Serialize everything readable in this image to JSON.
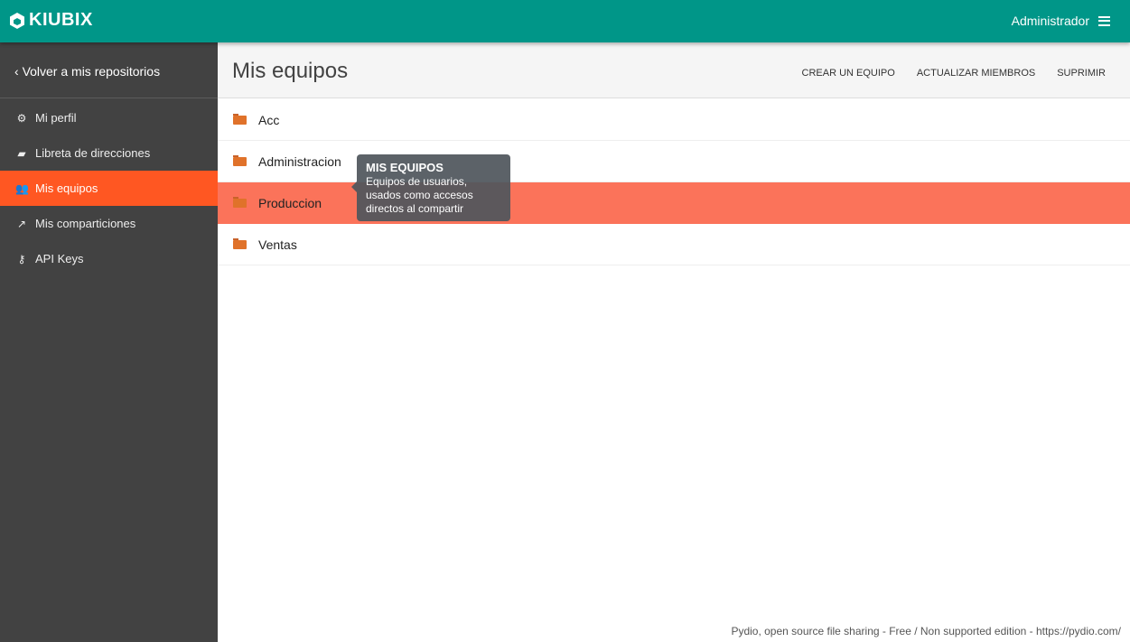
{
  "topbar": {
    "brand": "KIUBIX",
    "user": "Administrador"
  },
  "sidebar": {
    "back": "Volver a mis repositorios",
    "items": [
      {
        "label": "Mi perfil",
        "icon": "gear-icon"
      },
      {
        "label": "Libreta de direcciones",
        "icon": "book-icon"
      },
      {
        "label": "Mis equipos",
        "icon": "users-icon",
        "active": true
      },
      {
        "label": "Mis comparticiones",
        "icon": "share-icon"
      },
      {
        "label": "API Keys",
        "icon": "key-icon"
      }
    ]
  },
  "header": {
    "title": "Mis equipos",
    "actions": [
      "CREAR UN EQUIPO",
      "ACTUALIZAR MIEMBROS",
      "SUPRIMIR"
    ]
  },
  "teams": [
    "Acc",
    "Administracion",
    "Produccion",
    "Ventas"
  ],
  "tooltip": {
    "title": "MIS EQUIPOS",
    "text": "Equipos de usuarios, usados como accesos directos al compartir"
  },
  "footer": "Pydio, open source file sharing - Free / Non supported edition - https://pydio.com/",
  "colors": {
    "topbar": "#009688",
    "active": "#ff5722",
    "selected_row": "#fb735a"
  }
}
